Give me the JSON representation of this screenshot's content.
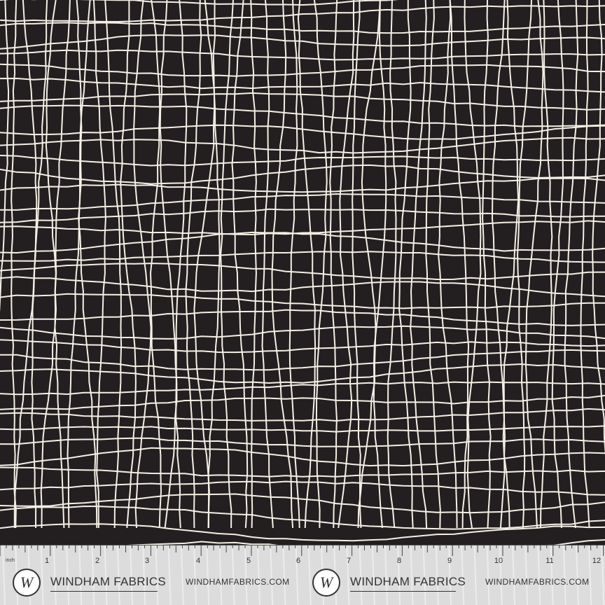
{
  "ruler": {
    "unit_label": "inch",
    "numbers": [
      "1",
      "2",
      "3",
      "4",
      "5",
      "6",
      "7",
      "8",
      "9",
      "10",
      "11",
      "12"
    ]
  },
  "branding": [
    {
      "logo_letter": "W",
      "name": "WINDHAM FABRICS",
      "website": "WINDHAMFABRICS.COM"
    },
    {
      "logo_letter": "W",
      "name": "WINDHAM FABRICS",
      "website": "WINDHAMFABRICS.COM"
    }
  ],
  "colors": {
    "background": "#231f20",
    "grid_lines": "#f4f0e6",
    "ruler": "#dcdcdc"
  }
}
